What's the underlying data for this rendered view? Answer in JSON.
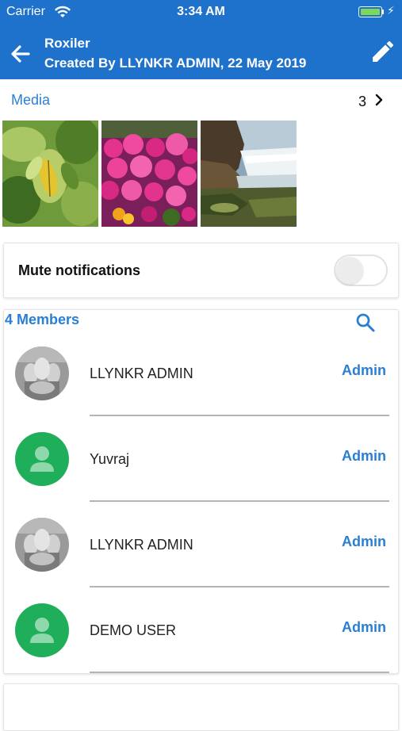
{
  "status_bar": {
    "carrier": "Carrier",
    "time": "3:34 AM",
    "battery_color": "#7ed957"
  },
  "header": {
    "title": "Roxiler",
    "subtitle": "Created By LLYNKR ADMIN, 22 May 2019",
    "back_icon": "arrow-left-icon",
    "edit_icon": "pencil-icon",
    "background": "#1e72cc"
  },
  "media": {
    "label": "Media",
    "count": "3",
    "thumbnails": [
      "leaf-photo",
      "flowers-photo",
      "waterfall-photo"
    ]
  },
  "mute": {
    "label": "Mute notifications",
    "enabled": false
  },
  "members": {
    "title": "4 Members",
    "search_icon": "search-icon",
    "list": [
      {
        "name": "LLYNKR ADMIN",
        "role": "Admin",
        "avatar": "photo"
      },
      {
        "name": "Yuvraj",
        "role": "Admin",
        "avatar": "default-person"
      },
      {
        "name": "LLYNKR ADMIN",
        "role": "Admin",
        "avatar": "photo"
      },
      {
        "name": "DEMO USER",
        "role": "Admin",
        "avatar": "default-person"
      }
    ]
  },
  "accent_color": "#2a7fd4",
  "avatar_green": "#1fae5a"
}
